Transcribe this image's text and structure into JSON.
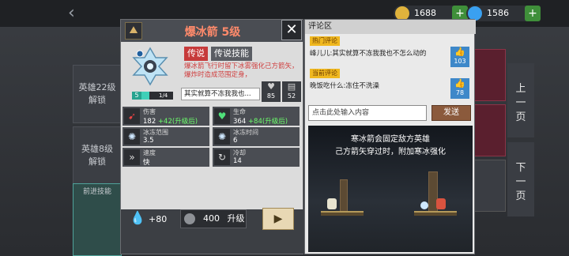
{
  "currencies": [
    {
      "name": "gold-coin-icon",
      "value": "1688"
    },
    {
      "name": "gem-icon",
      "value": "1586"
    }
  ],
  "left_panels": [
    "英雄22级\n解锁",
    "英雄8级\n解锁"
  ],
  "left_bottom": "前进技能",
  "page_buttons": {
    "prev": "上\n一\n页",
    "next": "下\n一\n页"
  },
  "skill": {
    "title": "爆冰箭 5级",
    "tag_rarity": "传说",
    "tag_type": "传说技能",
    "description": "爆冰箭飞行时留下冰雾强化己方箭矢，爆炸时造成范围定身，",
    "level": "5",
    "progress_label": "1/4",
    "progress_fraction": 0.25,
    "comment_preview": "其实就算不冻我我也...",
    "likes": "85",
    "comments": "52"
  },
  "stats": [
    {
      "icon": "damage-icon",
      "name": "伤害",
      "value": "182",
      "bonus": "+42(升级后)"
    },
    {
      "icon": "heart-icon",
      "name": "生命",
      "value": "364",
      "bonus": "+84(升级后)"
    },
    {
      "icon": "freeze-range-icon",
      "name": "冰冻范围",
      "value": "3.5",
      "bonus": ""
    },
    {
      "icon": "freeze-time-icon",
      "name": "冰冻时间",
      "value": "6",
      "bonus": ""
    },
    {
      "icon": "speed-icon",
      "name": "速度",
      "value": "快",
      "bonus": ""
    },
    {
      "icon": "cooldown-icon",
      "name": "冷却",
      "value": "14",
      "bonus": ""
    }
  ],
  "footer": {
    "gem_value": "+80",
    "upgrade_cost": "400",
    "upgrade_label": "升级"
  },
  "comments_panel": {
    "title": "评论区",
    "hot_tag": "热门评论",
    "hot_text": "峰儿儿:其实就算不冻我我也不怎么动的",
    "hot_likes": "103",
    "current_tag": "当前评论",
    "current_text": "晚饭吃什么:冻住不洗澡",
    "current_likes": "78",
    "input_placeholder": "点击此处输入内容",
    "send_label": "发送"
  },
  "scene_text": [
    "寒冰箭会固定敌方英雄",
    "己方箭矢穿过时，附加寒冰强化"
  ]
}
